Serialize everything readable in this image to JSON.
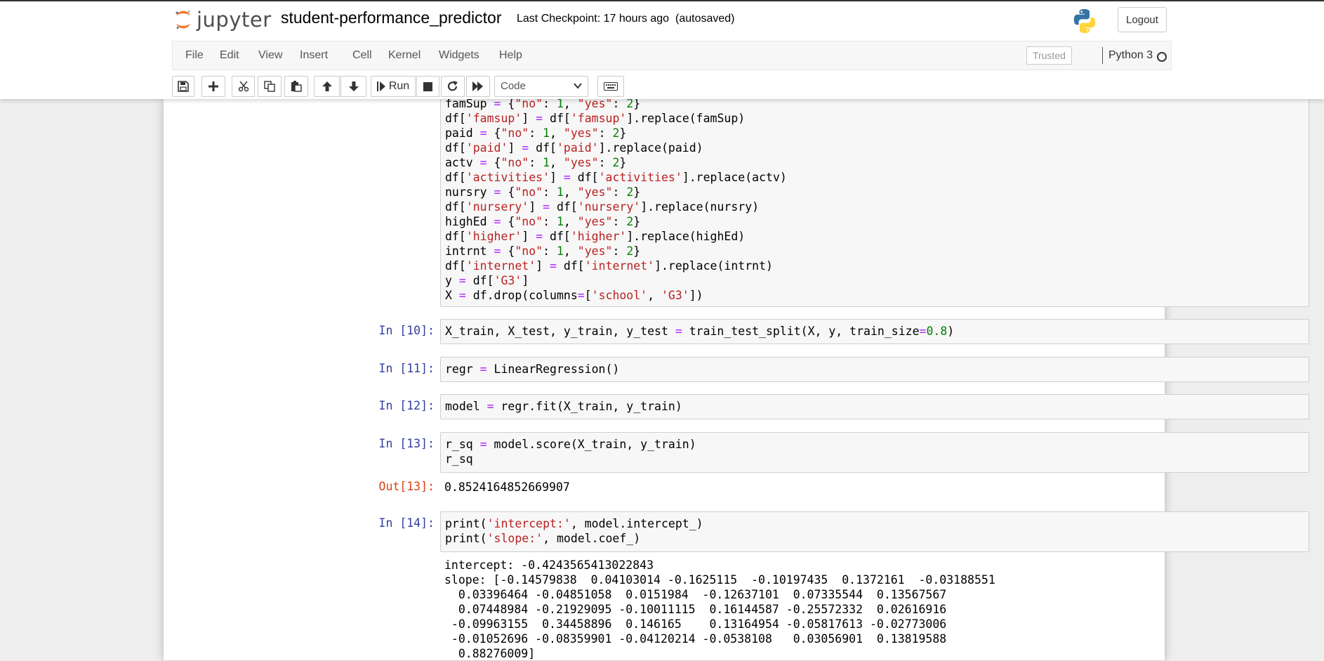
{
  "header": {
    "logo_text": "jupyter",
    "notebook_name": "student-performance_predictor",
    "checkpoint": "Last Checkpoint: 17 hours ago",
    "autosave": "(autosaved)",
    "logout_label": "Logout"
  },
  "menu": {
    "items": [
      "File",
      "Edit",
      "View",
      "Insert",
      "Cell",
      "Kernel",
      "Widgets",
      "Help"
    ],
    "trusted": "Trusted",
    "kernel_name": "Python 3"
  },
  "toolbar": {
    "run_label": "Run",
    "cell_type": "Code",
    "icons": [
      "save-icon",
      "plus-icon",
      "cut-icon",
      "copy-icon",
      "paste-icon",
      "arrow-up-icon",
      "arrow-down-icon",
      "run-icon",
      "stop-icon",
      "restart-icon",
      "fast-forward-icon",
      "cell-type-select",
      "keyboard-icon"
    ]
  },
  "cells": {
    "cell9": {
      "lines": [
        "famSup = {\"no\": 1, \"yes\": 2}",
        "df['famsup'] = df['famsup'].replace(famSup)",
        "paid = {\"no\": 1, \"yes\": 2}",
        "df['paid'] = df['paid'].replace(paid)",
        "actv = {\"no\": 1, \"yes\": 2}",
        "df['activities'] = df['activities'].replace(actv)",
        "nursry = {\"no\": 1, \"yes\": 2}",
        "df['nursery'] = df['nursery'].replace(nursry)",
        "highEd = {\"no\": 1, \"yes\": 2}",
        "df['higher'] = df['higher'].replace(highEd)",
        "intrnt = {\"no\": 1, \"yes\": 2}",
        "df['internet'] = df['internet'].replace(intrnt)",
        "y = df['G3']",
        "X = df.drop(columns=['school', 'G3'])"
      ]
    },
    "cell10": {
      "prompt": "In [10]:",
      "code": "X_train, X_test, y_train, y_test = train_test_split(X, y, train_size=0.8)"
    },
    "cell11": {
      "prompt": "In [11]:",
      "code": "regr = LinearRegression()"
    },
    "cell12": {
      "prompt": "In [12]:",
      "code": "model = regr.fit(X_train, y_train)"
    },
    "cell13": {
      "prompt": "In [13]:",
      "lines": [
        "r_sq = model.score(X_train, y_train)",
        "r_sq"
      ],
      "out_prompt": "Out[13]:",
      "output": "0.8524164852669907"
    },
    "cell14": {
      "prompt": "In [14]:",
      "lines": [
        "print('intercept:', model.intercept_)",
        "print('slope:', model.coef_)"
      ],
      "output": [
        "intercept: -0.4243565413022843",
        "slope: [-0.14579838  0.04103014 -0.1625115  -0.10197435  0.1372161  -0.03188551",
        "  0.03396464 -0.04851058  0.0151984  -0.12637101  0.07335544  0.13567567",
        "  0.07448984 -0.21929095 -0.10011115  0.16144587 -0.25572332  0.02616916",
        " -0.09963155  0.34458896  0.146165    0.13164954 -0.05817613 -0.02773006",
        " -0.01052696 -0.08359901 -0.04120214 -0.0538108   0.03056901  0.13819588",
        "  0.88276009]"
      ]
    }
  },
  "colors": {
    "prompt_in": "#303F9F",
    "prompt_out": "#D84315",
    "string": "#BA2121",
    "number": "#008000",
    "operator": "#AA22FF",
    "jupyter_orange": "#F37726"
  }
}
